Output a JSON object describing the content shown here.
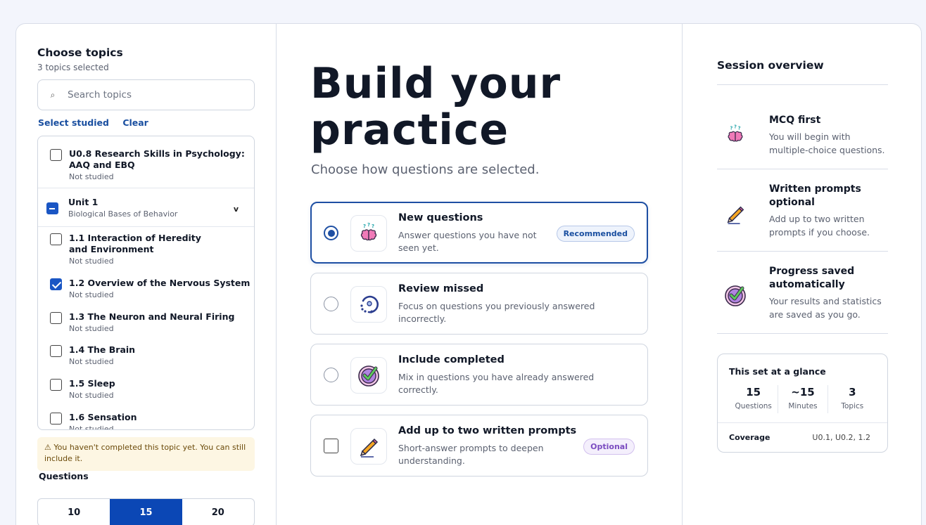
{
  "left": {
    "title": "Choose topics",
    "selected_count": "3 topics selected",
    "search_placeholder": "Search topics",
    "select_studied": "Select studied",
    "clear": "Clear",
    "topics": [
      {
        "name": "U0.8 Research Skills in Psychology: AAQ and EBQ",
        "status": "Not studied",
        "checked": false
      },
      {
        "name": "1.1 Interaction of Heredity and Environment",
        "status": "Not studied",
        "checked": false
      },
      {
        "name": "1.2 Overview of the Nervous System",
        "status": "Not studied",
        "checked": true
      },
      {
        "name": "1.3 The Neuron and Neural Firing",
        "status": "Not studied",
        "checked": false
      },
      {
        "name": "1.4 The Brain",
        "status": "Not studied",
        "checked": false
      },
      {
        "name": "1.5 Sleep",
        "status": "Not studied",
        "checked": false
      },
      {
        "name": "1.6 Sensation",
        "status": "Not studied",
        "checked": false
      }
    ],
    "unit": {
      "name": "Unit 1",
      "subtitle": "Biological Bases of Behavior",
      "chevron": "v"
    },
    "warning": "⚠ You haven't completed this topic yet. You can still include it.",
    "questions_label": "Questions",
    "question_counts": [
      "10",
      "15",
      "20"
    ],
    "selected_question_count": "15"
  },
  "center": {
    "headline_line1": "Build your",
    "headline_line2": "practice",
    "subhead": "Choose how questions are selected.",
    "options": [
      {
        "title": "New questions",
        "desc": "Answer questions you have not seen yet.",
        "badge": "Recommended",
        "selected": true,
        "icon": "brain-icon"
      },
      {
        "title": "Review missed",
        "desc": "Focus on questions you previously answered incorrectly.",
        "selected": false,
        "icon": "review-circle-icon"
      },
      {
        "title": "Include completed",
        "desc": "Mix in questions you have already answered correctly.",
        "selected": false,
        "icon": "check-badge-icon"
      },
      {
        "title": "Add up to two written prompts",
        "desc": "Short-answer prompts to deepen understanding.",
        "badge": "Optional",
        "selected": false,
        "icon": "pencil-icon"
      }
    ]
  },
  "right": {
    "title": "Session overview",
    "items": [
      {
        "title": "MCQ first",
        "desc": "You will begin with multiple-choice questions.",
        "icon": "brain-icon"
      },
      {
        "title": "Written prompts optional",
        "desc": "Add up to two written prompts if you choose.",
        "icon": "pencil-icon"
      },
      {
        "title": "Progress saved automatically",
        "desc": "Your results and statistics are saved as you go.",
        "icon": "check-badge-icon"
      }
    ],
    "glance": {
      "title": "This set at a glance",
      "stats": [
        {
          "value": "15",
          "label": "Questions"
        },
        {
          "value": "~15",
          "label": "Minutes"
        },
        {
          "value": "3",
          "label": "Topics"
        }
      ],
      "coverage_label": "Coverage",
      "coverage_value": "U0.1, U0.2, 1.2"
    }
  },
  "colors": {
    "accent": "#0b47b5",
    "selected_border": "#1e4fa3",
    "warning_bg": "#fdf6e3"
  }
}
